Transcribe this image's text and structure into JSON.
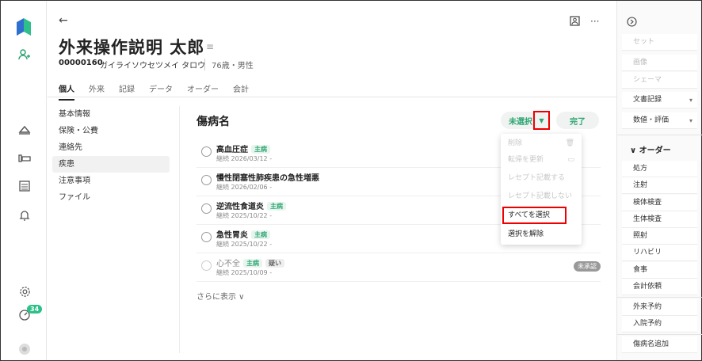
{
  "header": {
    "back": "←",
    "patient_name": "外来操作説明 太郎",
    "patient_id": "00000160",
    "kana": "ガイライソウセツメイ タロウ",
    "age_sex": "76歳・男性",
    "tabs": [
      "個人",
      "外来",
      "記録",
      "データ",
      "オーダー",
      "会計"
    ]
  },
  "rail": {
    "notification_count": "34"
  },
  "left_menu": [
    "基本情報",
    "保険・公費",
    "連絡先",
    "疾患",
    "注意事項",
    "ファイル"
  ],
  "main": {
    "title": "傷病名",
    "select_button": "未選択",
    "done_button": "完了",
    "diseases": [
      {
        "name": "高血圧症",
        "tags": [
          "主病"
        ],
        "sub": "継続 2026/03/12 -"
      },
      {
        "name": "慢性閉塞性肺疾患の急性増悪",
        "tags": [],
        "sub": "継続 2026/02/06 -"
      },
      {
        "name": "逆流性食道炎",
        "tags": [
          "主病"
        ],
        "sub": "継続 2025/10/22 -"
      },
      {
        "name": "急性胃炎",
        "tags": [
          "主病"
        ],
        "sub": "継続 2025/10/22 -"
      },
      {
        "name": "心不全",
        "tags": [
          "主病",
          "疑い"
        ],
        "sub": "継続 2025/10/09 -",
        "status": "未承認"
      }
    ],
    "show_more": "さらに表示 ∨"
  },
  "dropdown": {
    "items": [
      {
        "label": "削除",
        "enabled": false
      },
      {
        "label": "転帰を更新",
        "enabled": false
      },
      {
        "label": "レセプト記載する",
        "enabled": false
      },
      {
        "label": "レセプト記載しない",
        "enabled": false
      },
      {
        "label": "すべてを選択",
        "enabled": true
      },
      {
        "label": "選択を解除",
        "enabled": true
      }
    ]
  },
  "right_panel": {
    "top_items": [
      "セット",
      "画像",
      "シェーマ"
    ],
    "select_items": [
      "文書記録",
      "数値・評価"
    ],
    "order_heading": "∨ オーダー",
    "order_items": [
      "処方",
      "注射",
      "検体検査",
      "生体検査",
      "照射",
      "リハビリ",
      "食事",
      "会計依頼"
    ],
    "bottom_items": [
      "外来予約",
      "入院予約",
      "傷病名追加"
    ]
  },
  "colors": {
    "accent_green": "#2ea572",
    "highlight_red": "#e00000"
  }
}
